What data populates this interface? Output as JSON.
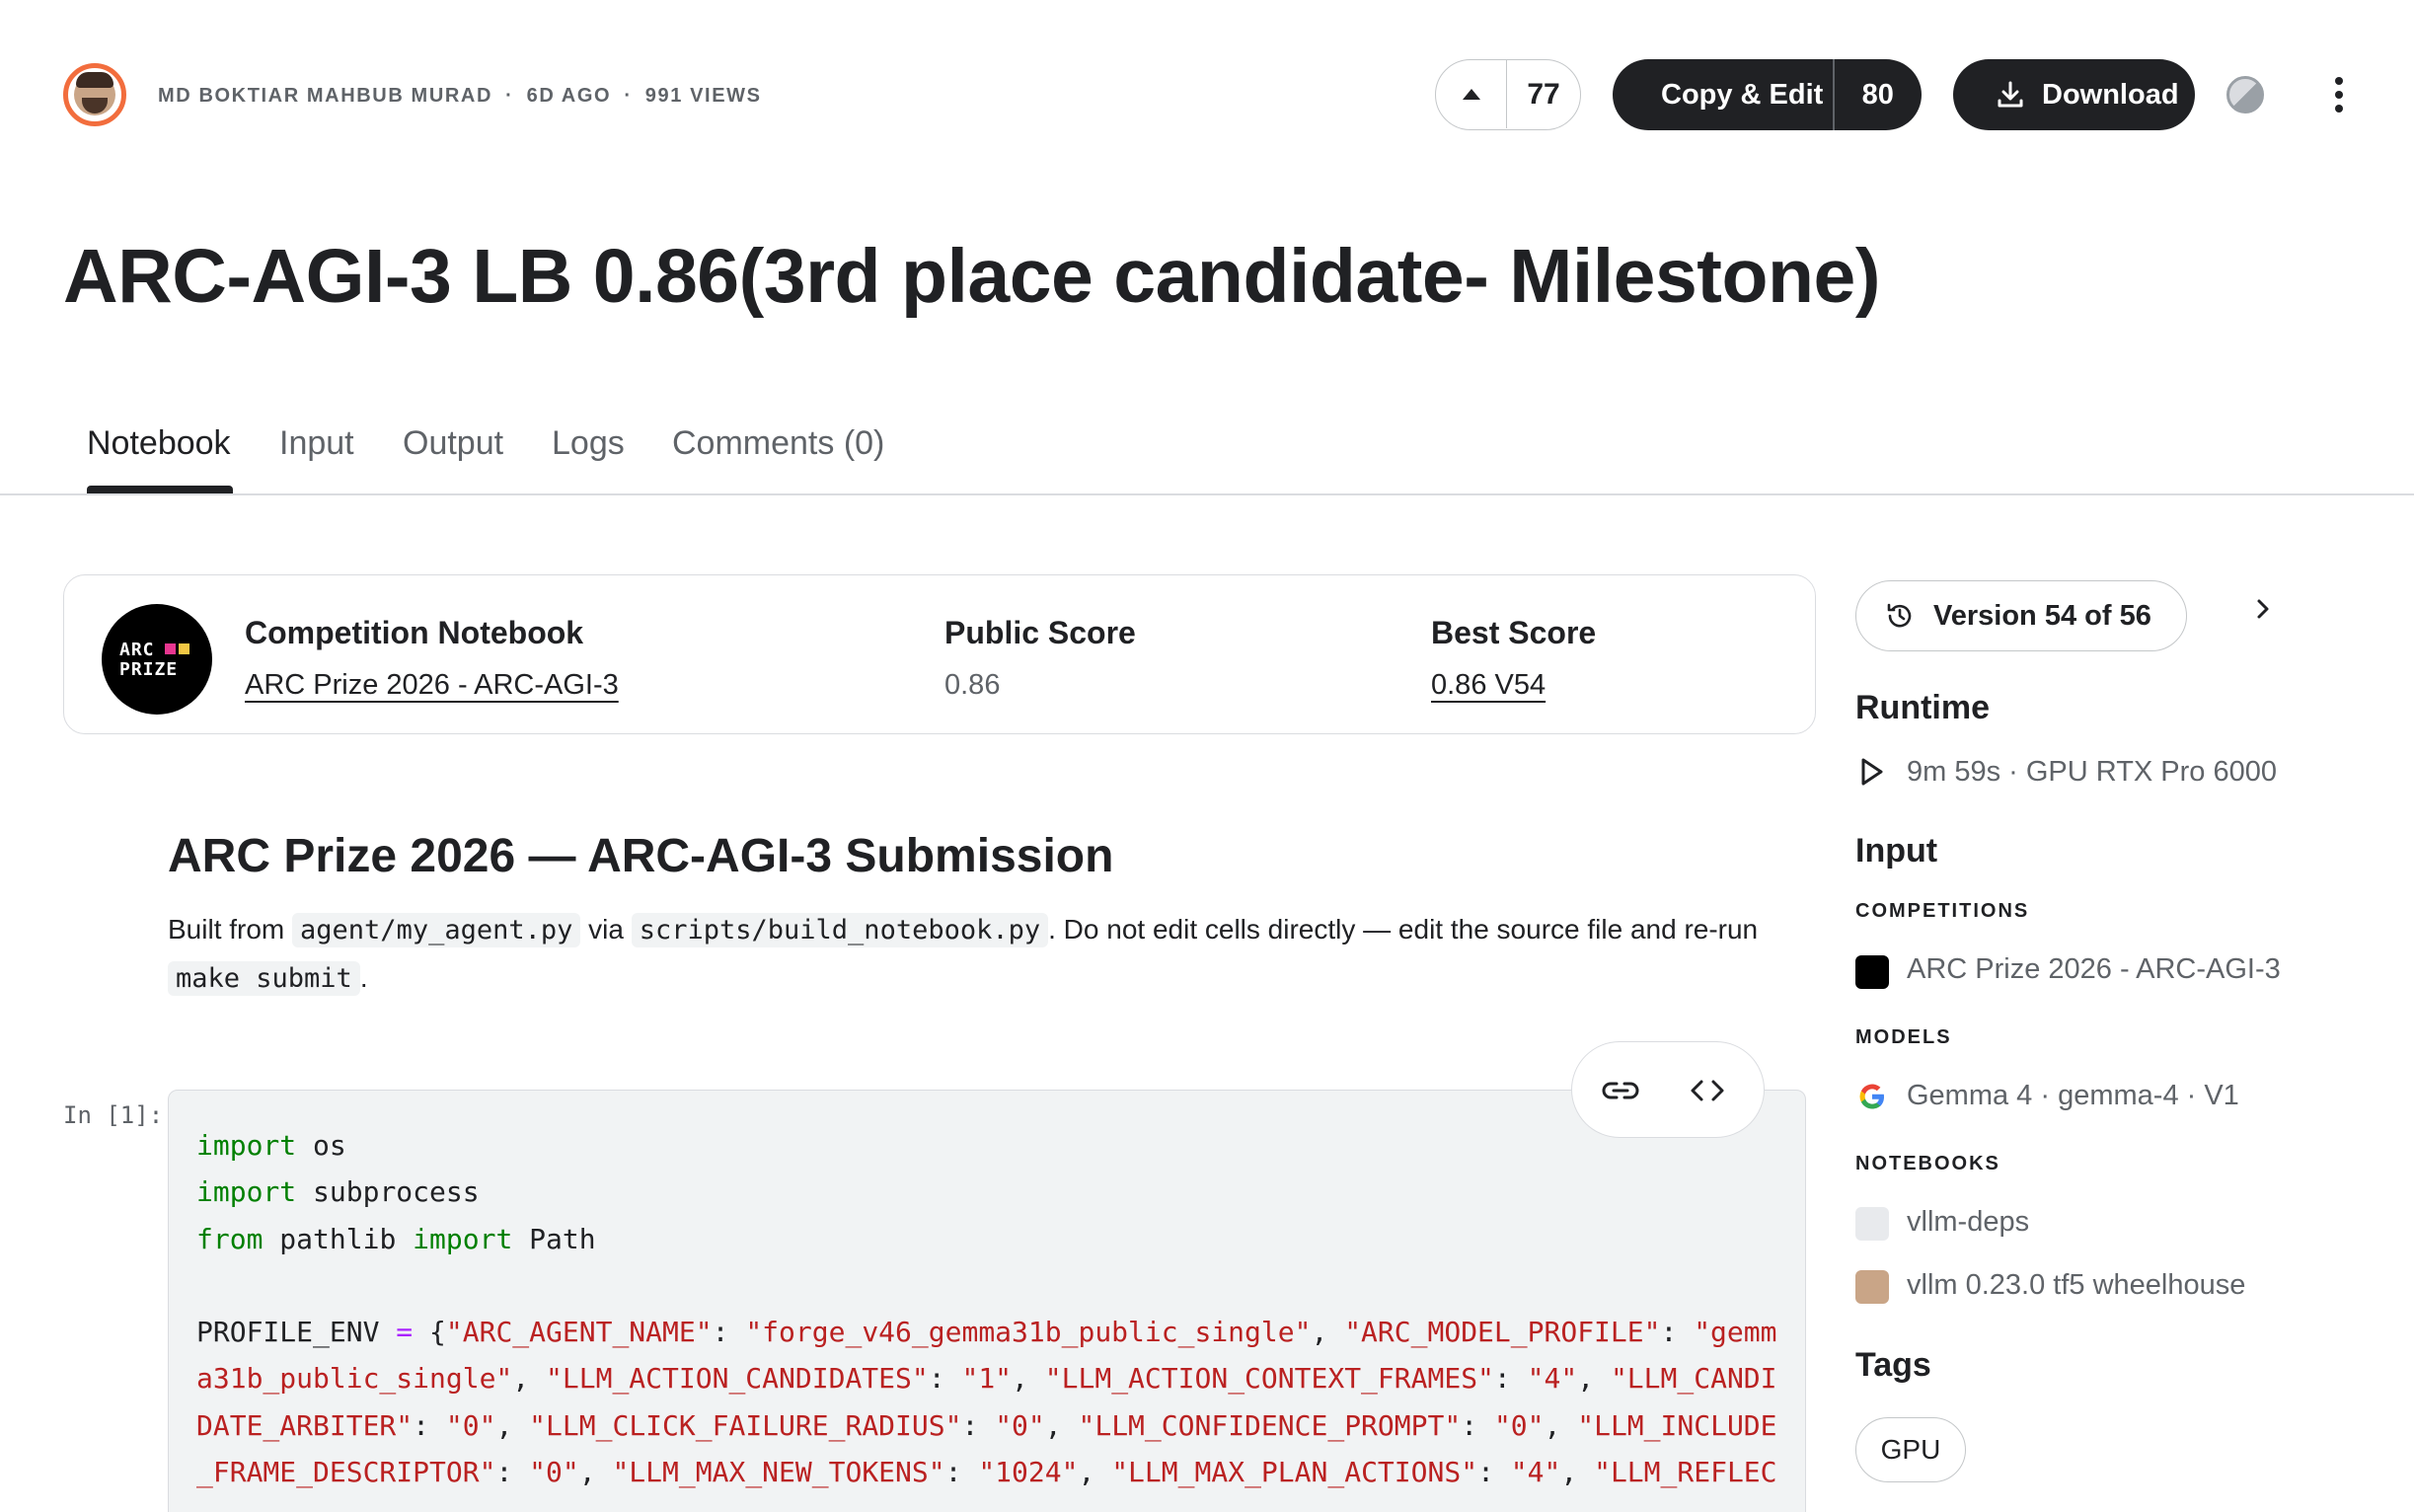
{
  "author": {
    "name": "MD BOKTIAR MAHBUB MURAD",
    "time_ago": "6D AGO",
    "views": "991 VIEWS",
    "separator": "·"
  },
  "actions": {
    "upvotes": "77",
    "copy_edit_label": "Copy & Edit",
    "copy_edit_count": "80",
    "download_label": "Download"
  },
  "title": "ARC-AGI-3 LB 0.86(3rd place candidate- Milestone)",
  "tabs": [
    {
      "label": "Notebook",
      "active": true
    },
    {
      "label": "Input",
      "active": false
    },
    {
      "label": "Output",
      "active": false
    },
    {
      "label": "Logs",
      "active": false
    },
    {
      "label": "Comments (0)",
      "active": false
    }
  ],
  "competition": {
    "logo_line1": "ARC",
    "logo_line2": "PRIZE",
    "logo_colors": [
      "#e8368f",
      "#f2c744"
    ],
    "label": "Competition Notebook",
    "name": "ARC Prize 2026 - ARC-AGI-3",
    "public_score_label": "Public Score",
    "public_score": "0.86",
    "best_score_label": "Best Score",
    "best_score": "0.86 V54"
  },
  "markdown": {
    "heading": "ARC Prize 2026 — ARC-AGI-3 Submission",
    "p_text1": "Built from ",
    "p_code1": "agent/my_agent.py",
    "p_text2": " via ",
    "p_code2": "scripts/build_notebook.py",
    "p_text3": ". Do not edit cells directly — edit the source file and re-run ",
    "p_code3": "make submit",
    "p_text4": "."
  },
  "cell": {
    "prompt": "In [1]:",
    "lines": [
      [
        {
          "t": "import",
          "c": "kw"
        },
        {
          "t": " os",
          "c": ""
        }
      ],
      [
        {
          "t": "import",
          "c": "kw"
        },
        {
          "t": " subprocess",
          "c": ""
        }
      ],
      [
        {
          "t": "from",
          "c": "kw"
        },
        {
          "t": " pathlib ",
          "c": ""
        },
        {
          "t": "import",
          "c": "kw"
        },
        {
          "t": " Path",
          "c": ""
        }
      ],
      [],
      [
        {
          "t": "PROFILE_ENV ",
          "c": ""
        },
        {
          "t": "=",
          "c": "op"
        },
        {
          "t": " {",
          "c": ""
        },
        {
          "t": "\"ARC_AGENT_NAME\"",
          "c": "str"
        },
        {
          "t": ": ",
          "c": ""
        },
        {
          "t": "\"forge_v46_gemma31b_public_single\"",
          "c": "str"
        },
        {
          "t": ", ",
          "c": ""
        },
        {
          "t": "\"ARC_MODEL_PROFILE\"",
          "c": "str"
        },
        {
          "t": ": ",
          "c": ""
        },
        {
          "t": "\"gemm",
          "c": "str"
        }
      ],
      [
        {
          "t": "a31b_public_single\"",
          "c": "str"
        },
        {
          "t": ", ",
          "c": ""
        },
        {
          "t": "\"LLM_ACTION_CANDIDATES\"",
          "c": "str"
        },
        {
          "t": ": ",
          "c": ""
        },
        {
          "t": "\"1\"",
          "c": "str"
        },
        {
          "t": ", ",
          "c": ""
        },
        {
          "t": "\"LLM_ACTION_CONTEXT_FRAMES\"",
          "c": "str"
        },
        {
          "t": ": ",
          "c": ""
        },
        {
          "t": "\"4\"",
          "c": "str"
        },
        {
          "t": ", ",
          "c": ""
        },
        {
          "t": "\"LLM_CANDI",
          "c": "str"
        }
      ],
      [
        {
          "t": "DATE_ARBITER\"",
          "c": "str"
        },
        {
          "t": ": ",
          "c": ""
        },
        {
          "t": "\"0\"",
          "c": "str"
        },
        {
          "t": ", ",
          "c": ""
        },
        {
          "t": "\"LLM_CLICK_FAILURE_RADIUS\"",
          "c": "str"
        },
        {
          "t": ": ",
          "c": ""
        },
        {
          "t": "\"0\"",
          "c": "str"
        },
        {
          "t": ", ",
          "c": ""
        },
        {
          "t": "\"LLM_CONFIDENCE_PROMPT\"",
          "c": "str"
        },
        {
          "t": ": ",
          "c": ""
        },
        {
          "t": "\"0\"",
          "c": "str"
        },
        {
          "t": ", ",
          "c": ""
        },
        {
          "t": "\"LLM_INCLUDE",
          "c": "str"
        }
      ],
      [
        {
          "t": "_FRAME_DESCRIPTOR\"",
          "c": "str"
        },
        {
          "t": ": ",
          "c": ""
        },
        {
          "t": "\"0\"",
          "c": "str"
        },
        {
          "t": ", ",
          "c": ""
        },
        {
          "t": "\"LLM_MAX_NEW_TOKENS\"",
          "c": "str"
        },
        {
          "t": ": ",
          "c": ""
        },
        {
          "t": "\"1024\"",
          "c": "str"
        },
        {
          "t": ", ",
          "c": ""
        },
        {
          "t": "\"LLM_MAX_PLAN_ACTIONS\"",
          "c": "str"
        },
        {
          "t": ": ",
          "c": ""
        },
        {
          "t": "\"4\"",
          "c": "str"
        },
        {
          "t": ", ",
          "c": ""
        },
        {
          "t": "\"LLM_REFLEC",
          "c": "str"
        }
      ]
    ]
  },
  "sidebar": {
    "version_label": "Version 54 of 56",
    "runtime_heading": "Runtime",
    "runtime_value": "9m 59s · GPU RTX Pro 6000",
    "input_heading": "Input",
    "competitions_label": "COMPETITIONS",
    "competition_item": "ARC Prize 2026 - ARC-AGI-3",
    "models_label": "MODELS",
    "model_item": "Gemma 4 · gemma-4 · V1",
    "notebooks_label": "NOTEBOOKS",
    "notebook_items": [
      "vllm-deps",
      "vllm 0.23.0 tf5 wheelhouse"
    ],
    "tags_heading": "Tags",
    "tags": [
      "GPU"
    ]
  }
}
